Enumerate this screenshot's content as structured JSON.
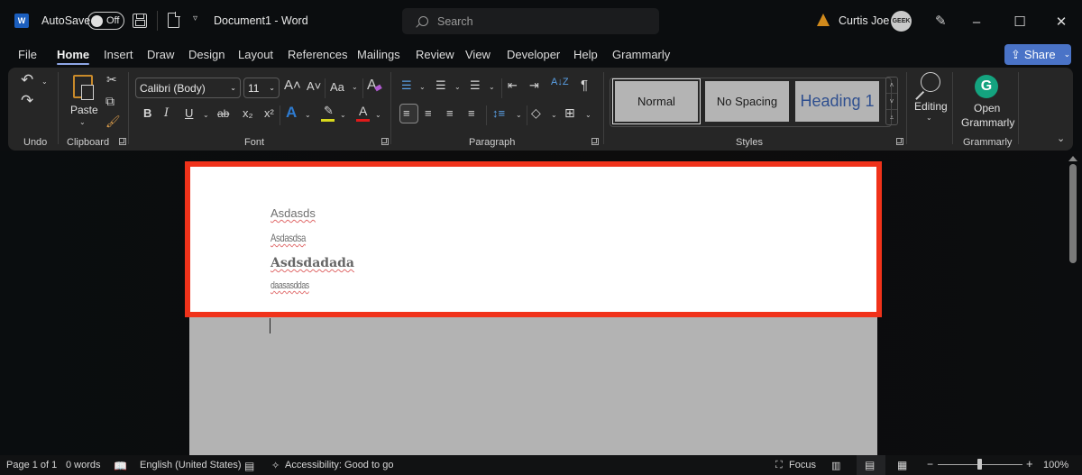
{
  "titlebar": {
    "app_icon": "word-logo-icon",
    "app_letter": "W",
    "autosave_label": "AutoSave",
    "autosave_state": "Off",
    "doc_title": "Document1  -  Word",
    "search_placeholder": "Search",
    "warning_icon": "warning-icon",
    "user_name": "Curtis Joe",
    "avatar_text": "GEEK",
    "window_controls": {
      "minimize": "–",
      "maximize": "☐",
      "close": "✕"
    }
  },
  "tabs": [
    {
      "label": "File"
    },
    {
      "label": "Home",
      "active": true
    },
    {
      "label": "Insert"
    },
    {
      "label": "Draw"
    },
    {
      "label": "Design"
    },
    {
      "label": "Layout"
    },
    {
      "label": "References"
    },
    {
      "label": "Mailings"
    },
    {
      "label": "Review"
    },
    {
      "label": "View"
    },
    {
      "label": "Developer"
    },
    {
      "label": "Help"
    },
    {
      "label": "Grammarly"
    }
  ],
  "share": {
    "label": "Share",
    "chevron": "⌄"
  },
  "ribbon": {
    "undo": {
      "label": "Undo",
      "undo_glyph": "↶",
      "redo_glyph": "↷"
    },
    "clipboard": {
      "label": "Clipboard",
      "paste_label": "Paste",
      "cut_glyph": "✂",
      "copy_glyph": "⧉",
      "painter_glyph": "🖌"
    },
    "font": {
      "label": "Font",
      "font_name": "Calibri (Body)",
      "font_size": "11",
      "grow": "A˄",
      "shrink": "A˅",
      "change_case": "Aa",
      "clear_formatting": "A",
      "bold": "B",
      "italic": "I",
      "underline": "U",
      "strikethrough": "ab",
      "subscript": "x₂",
      "superscript": "x²",
      "text_effects": "A",
      "highlight_color": "#d8d81c",
      "font_color": "#e01a1a"
    },
    "paragraph": {
      "label": "Paragraph",
      "pilcrow": "¶",
      "sort": "A↓Z"
    },
    "styles": {
      "label": "Styles",
      "items": [
        {
          "label": "Normal",
          "selected": true
        },
        {
          "label": "No Spacing"
        },
        {
          "label": "Heading 1"
        }
      ]
    },
    "editing": {
      "label": "Editing"
    },
    "grammarly": {
      "open_line1": "Open",
      "open_line2": "Grammarly",
      "group_label": "Grammarly",
      "logo_letter": "G"
    }
  },
  "document": {
    "lines": [
      {
        "text": "Asdasds",
        "style": "sans"
      },
      {
        "text": "Asdasdsa",
        "style": "condensed"
      },
      {
        "text": "Asdsdadada",
        "style": "bold-serif"
      },
      {
        "text": "daasasddas",
        "style": "condensed-small"
      }
    ],
    "highlight_color": "#f0321a"
  },
  "statusbar": {
    "page": "Page 1 of 1",
    "words": "0 words",
    "language": "English (United States)",
    "accessibility": "Accessibility: Good to go",
    "focus": "Focus",
    "zoom_level": "100%",
    "zoom_minus": "−",
    "zoom_plus": "+"
  }
}
